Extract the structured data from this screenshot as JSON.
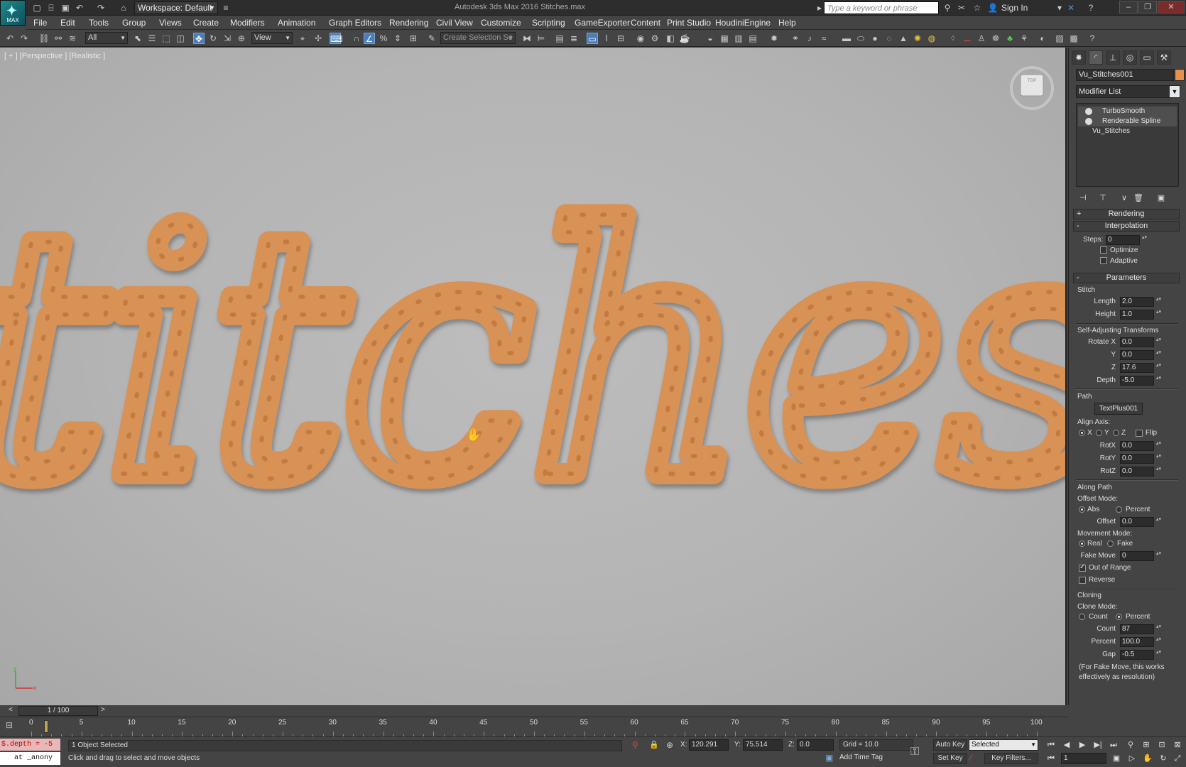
{
  "title_bar": {
    "app_logo_text": "MAX",
    "workspace": "Workspace: Default",
    "window_title": "Autodesk 3ds Max 2016      Stitches.max",
    "search_placeholder": "Type a keyword or phrase",
    "sign_in": "Sign In"
  },
  "menu": [
    "File",
    "Edit",
    "Tools",
    "Group",
    "Views",
    "Create",
    "Modifiers",
    "Animation",
    "Graph Editors",
    "Rendering",
    "Civil View",
    "Customize",
    "Scripting",
    "GameExporter",
    "Content",
    "Print Studio",
    "HoudiniEngine",
    "Help"
  ],
  "toolbar": {
    "selection_filter": "All",
    "ref_coord": "View",
    "named_selection": "Create Selection Se"
  },
  "viewport": {
    "label": "[ + ] [Perspective ] [Realistic ]",
    "viewcube_label": "TOP",
    "text_content": "titches",
    "axis_x": "x",
    "axis_y": "y"
  },
  "command_panel": {
    "object_name": "Vu_Stitches001",
    "object_color": "#e6924f",
    "modifier_list": "Modifier List",
    "stack": [
      {
        "label": "TurboSmooth"
      },
      {
        "label": "Renderable Spline"
      },
      {
        "label": "Vu_Stitches"
      }
    ],
    "rollouts": {
      "rendering": "Rendering",
      "interpolation": "Interpolation",
      "parameters": "Parameters"
    },
    "interpolation": {
      "steps_label": "Steps:",
      "steps_value": "0",
      "optimize": "Optimize",
      "adaptive": "Adaptive"
    },
    "stitch": {
      "group": "Stitch",
      "length_label": "Length",
      "length": "2.0",
      "height_label": "Height",
      "height": "1.0"
    },
    "self_adjusting": {
      "group": "Self-Adjusting Transforms",
      "rotx_label": "Rotate X",
      "rotx": "0.0",
      "y_label": "Y",
      "y": "0.0",
      "z_label": "Z",
      "z": "17.6",
      "depth_label": "Depth",
      "depth": "-5.0"
    },
    "path": {
      "group": "Path",
      "path_button": "TextPlus001",
      "align_axis": "Align Axis:",
      "x": "X",
      "y": "Y",
      "z": "Z",
      "flip": "Flip",
      "rotx_label": "RotX",
      "rotx": "0.0",
      "roty_label": "RotY",
      "roty": "0.0",
      "rotz_label": "RotZ",
      "rotz": "0.0"
    },
    "along_path": {
      "group": "Along Path",
      "offset_mode": "Offset Mode:",
      "abs": "Abs",
      "percent": "Percent",
      "offset_label": "Offset",
      "offset": "0.0",
      "movement_mode": "Movement Mode:",
      "real": "Real",
      "fake": "Fake",
      "fake_move_label": "Fake Move",
      "fake_move": "0",
      "out_of_range": "Out of Range",
      "reverse": "Reverse"
    },
    "cloning": {
      "group": "Cloning",
      "clone_mode": "Clone Mode:",
      "count_opt": "Count",
      "percent_opt": "Percent",
      "count_label": "Count",
      "count": "87",
      "percent_label": "Percent",
      "percent": "100.0",
      "gap_label": "Gap",
      "gap": "-0.5",
      "note": "(For Fake Move, this works effectively as resolution)"
    }
  },
  "timeline": {
    "frame_display": "1 / 100",
    "ticks": [
      "0",
      "5",
      "10",
      "15",
      "20",
      "25",
      "30",
      "35",
      "40",
      "45",
      "50",
      "55",
      "60",
      "65",
      "70",
      "75",
      "80",
      "85",
      "90",
      "95",
      "100"
    ]
  },
  "status": {
    "maxscript_line1": "$.depth = -5",
    "maxscript_line2": "at _anony",
    "selection": "1 Object Selected",
    "prompt": "Click and drag to select and move objects",
    "x_label": "X:",
    "x": "120.291",
    "y_label": "Y:",
    "y": "75.514",
    "z_label": "Z:",
    "z": "0.0",
    "grid": "Grid = 10.0",
    "add_time_tag": "Add Time Tag",
    "auto_key": "Auto Key",
    "key_mode": "Selected",
    "set_key": "Set Key",
    "key_filters": "Key Filters...",
    "frame": "1"
  }
}
